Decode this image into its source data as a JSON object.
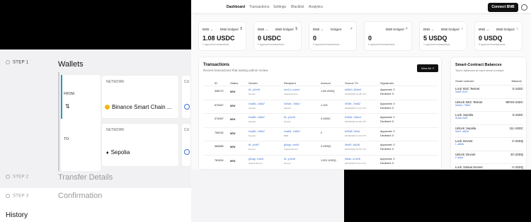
{
  "wallets": {
    "step1_label": "STEP 1",
    "step1_title": "Wallets",
    "network_label": "NETWORK",
    "cup_label": "CU",
    "from_label": "FROM:",
    "to_label": "TO:",
    "from_network": "Binance Smart Chain ...",
    "to_network": "Sepolia",
    "step2_label": "STEP 2",
    "step2_title": "Transfer Details",
    "step3_label": "STEP 3",
    "step3_title": "Confirmation",
    "history": "History"
  },
  "nav": {
    "items": [
      "Dashboard",
      "Transactions",
      "Settings",
      "Blacklist",
      "Analytics"
    ],
    "connect": "Connect BNB"
  },
  "stats": [
    {
      "label": "BNB →",
      "label2": "BNB bridged",
      "icon": "$",
      "value": "1.08 USDC",
      "sub": "1 approved transactions"
    },
    {
      "label": "BNB →",
      "label2": "BNB bridged",
      "icon": "$",
      "value": "0 USDC",
      "sub": "0 approved transactions"
    },
    {
      "label": "BNB →",
      "label2": "bridged",
      "icon": "↗",
      "value": "0",
      "sub": "0 approved transactions"
    },
    {
      "label": "",
      "label2": "BNB bridged",
      "icon": "↗",
      "value": "0",
      "sub": "0 approved transactions"
    },
    {
      "label": "BNB →",
      "label2": "BNB bridged",
      "icon": "○",
      "value": "5 USDQ",
      "sub": "1 approved transactions"
    },
    {
      "label": "BNB →",
      "label2": "BNB bridged",
      "icon": "○",
      "value": "0 USDQ",
      "sub": "0 approved transactions"
    }
  ],
  "transactions": {
    "title": "Transactions",
    "subtitle": "Recent transactions that waiting admin review",
    "view_all": "View All ↗",
    "headers": [
      "ID",
      "Status",
      "Sender",
      "Recipient",
      "Amount",
      "Source TX",
      "Signatures"
    ],
    "rows": [
      {
        "id": "338772",
        "status": "NEW",
        "sender": "fA..y2zh8",
        "sender_net": "Devnet",
        "recipient": "ncxCu..ccent",
        "recipient_net": "Solana Devnet",
        "amount": "1.05 USDQ",
        "tx": "bd5e0..82ae4",
        "tx_date": "02/06/2025 14:38 UTC",
        "approved": "Approved: 0",
        "declined": "Declined: 0"
      },
      {
        "id": "672647",
        "status": "NEW",
        "sender": "0xa86..1d8a7",
        "sender_net": "Sepolia",
        "recipient": "0x0ab..7d8a7",
        "recipient_net": "Wanchi",
        "amount": "1.123",
        "tx": "593fb..7bd62",
        "tx_date": "02/06/2025 13:14 UTC",
        "approved": "Approved: 0",
        "declined": "Declined: 0"
      },
      {
        "id": "374357",
        "status": "NEW",
        "sender": "0xa86..1d8a7",
        "sender_net": "Sepolia",
        "recipient": "fA..y2zh8",
        "recipient_net": "Devnet",
        "amount": "3 USDC",
        "tx": "0x6d6..33ac4",
        "tx_date": "02/05/2025 16:26 UTC",
        "approved": "Approved: 0",
        "declined": "Declined: 0"
      },
      {
        "id": "796192",
        "status": "NEW",
        "sender": "0xa86..1d8a7",
        "sender_net": "Sepolia",
        "recipient": "0xa86..1d8a7",
        "recipient_net": "BNB",
        "amount": "2",
        "tx": "b35d8..0b0a",
        "tx_date": "02/05/2025 11:04 UTC",
        "approved": "Approved: 0",
        "declined": "Declined: 0"
      },
      {
        "id": "366685",
        "status": "NEW",
        "sender": "fA..k4r87",
        "sender_net": "Devnet",
        "recipient": "gNrqp..bcK6",
        "recipient_net": "Solana Devnet",
        "amount": "3 USDQ",
        "tx": "4ehf0..8a1f6",
        "tx_date": "02/04/2025 10:52 UTC",
        "approved": "Approved: 0",
        "declined": "Declined: 0"
      },
      {
        "id": "781524",
        "status": "NEW",
        "sender": "gNrqp..bcK6",
        "sender_net": "Solana Devnet",
        "recipient": "fA..y2zh8",
        "recipient_net": "Devnet",
        "amount": "1.021 USDQ",
        "tx": "5dfac..a7ee6",
        "tx_date": "02/04/2025 10:11 UTC",
        "approved": "Approved: 0",
        "declined": "Declined: 0"
      }
    ]
  },
  "smart_contracts": {
    "title": "Smart-Contract Balances",
    "subtitle": "Token balances at each smart contract",
    "col_contract": "Smart contract",
    "col_balance": "Balance",
    "items": [
      {
        "name": "Lock: BSC Testnet",
        "addr": "0xd8F..6a74",
        "balance": "0 USDC"
      },
      {
        "name": "Unlock: BSC Testnet",
        "addr": "0x6a1e..7082d",
        "balance": "98745 USDC"
      },
      {
        "name": "Lock: Sepolia",
        "addr": "0x4a8..5ae1",
        "balance": "0 USDC"
      },
      {
        "name": "Unlock: Sepolia",
        "addr": "0xa0f...a8b2e",
        "balance": "111 USDC"
      },
      {
        "name": "Lock:          Devnet",
        "addr": "f...a8b6e",
        "balance": "0 USDQ"
      },
      {
        "name": "Unlock:          Devnet",
        "addr": "F..d6pm",
        "balance": "20 USDQ"
      },
      {
        "name": "Lock: Solana Devnet",
        "addr": "",
        "balance": "0 USDQ"
      }
    ]
  }
}
